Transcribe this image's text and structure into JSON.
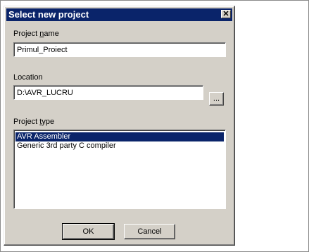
{
  "dialog": {
    "title": "Select new project",
    "close_symbol": "✕"
  },
  "project_name": {
    "label_prefix": "Project ",
    "label_accel": "n",
    "label_suffix": "ame",
    "value": "Primul_Proiect"
  },
  "location": {
    "label": "Location",
    "value": "D:\\AVR_LUCRU",
    "browse_label": "..."
  },
  "project_type": {
    "label_prefix": "Project ",
    "label_accel": "t",
    "label_suffix": "ype",
    "items": [
      {
        "label": "AVR Assembler",
        "selected": true
      },
      {
        "label": "Generic 3rd party C compiler",
        "selected": false
      }
    ]
  },
  "buttons": {
    "ok": "OK",
    "cancel": "Cancel"
  },
  "colors": {
    "titlebar": "#0a246a",
    "dialog_face": "#d4d0c8",
    "selection": "#0a246a"
  }
}
